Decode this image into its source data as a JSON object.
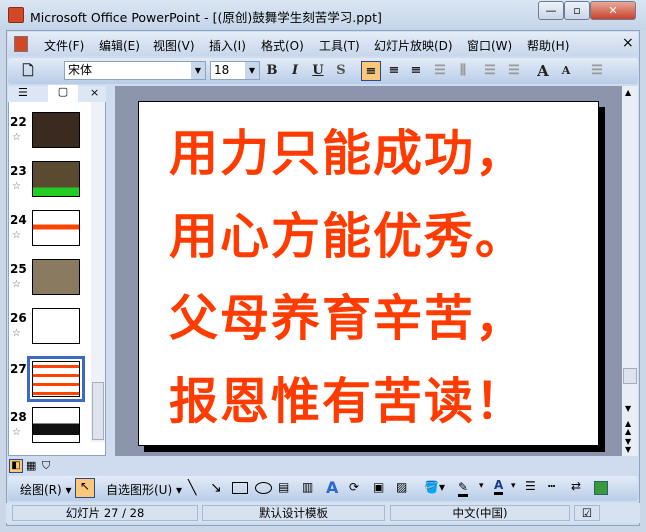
{
  "window": {
    "title": "Microsoft Office PowerPoint - [(原创)鼓舞学生刻苦学习.ppt]",
    "min": "—",
    "max": "▫",
    "close": "✕"
  },
  "menu": [
    "文件(F)",
    "编辑(E)",
    "视图(V)",
    "插入(I)",
    "格式(O)",
    "工具(T)",
    "幻灯片放映(D)",
    "窗口(W)",
    "帮助(H)"
  ],
  "menu_close": "×",
  "toolbar": {
    "font": "宋体",
    "size": "18",
    "bold": "B",
    "italic": "I",
    "underline": "U",
    "shadow": "S",
    "grow": "A",
    "shrink": "A"
  },
  "pane": {
    "close": "×",
    "slides": [
      {
        "n": "22"
      },
      {
        "n": "23"
      },
      {
        "n": "24"
      },
      {
        "n": "25"
      },
      {
        "n": "26"
      },
      {
        "n": "27",
        "selected": true
      },
      {
        "n": "28"
      }
    ]
  },
  "slide": {
    "lines": [
      "用力只能成功，",
      "用心方能优秀。",
      "父母养育辛苦，",
      "报恩惟有苦读！"
    ],
    "color": "#ff3b00"
  },
  "drawbar": {
    "draw": "绘图(R)",
    "autoshapes": "自选图形(U)"
  },
  "status": {
    "slide": "幻灯片 27 / 28",
    "template": "默认设计模板",
    "language": "中文(中国)"
  }
}
